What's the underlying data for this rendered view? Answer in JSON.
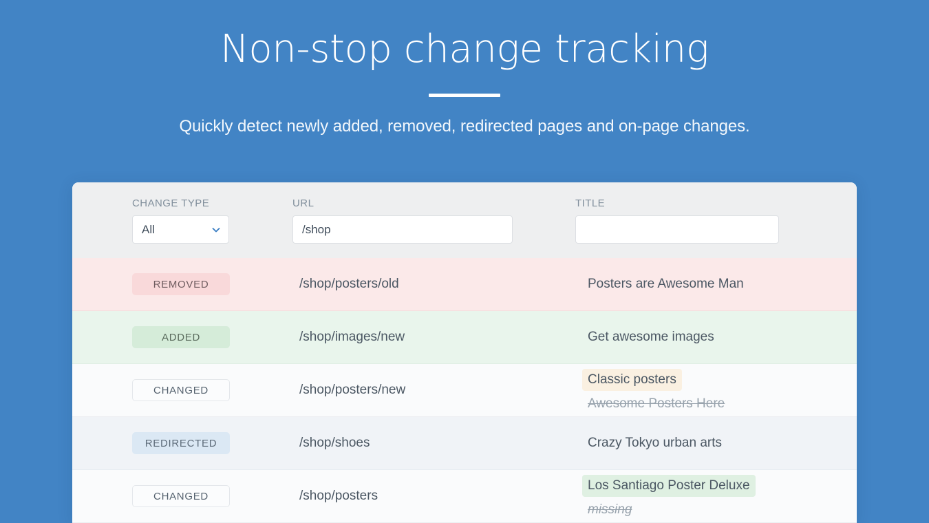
{
  "hero": {
    "title": "Non-stop change tracking",
    "subtitle": "Quickly detect newly added, removed, redirected pages and on-page changes."
  },
  "colors": {
    "background": "#4284c5",
    "accent": "#3c7fc4",
    "card": "#ffffff",
    "filter_bar": "#eeeff0",
    "row_removed": "#fbe9e9",
    "row_added": "#e9f5ec",
    "row_changed": "#fafbfc",
    "row_redirected": "#f0f3f7",
    "badge_removed": "#f9d9da",
    "badge_added": "#d5ecd9",
    "badge_redirected": "#dbe8f4",
    "highlight_cream": "#faf0e1",
    "highlight_green": "#dff0e2"
  },
  "filters": {
    "change_type": {
      "label": "Change type",
      "value": "All",
      "icon": "chevron-down-icon",
      "options": [
        "All"
      ]
    },
    "url": {
      "label": "URL",
      "value": "/shop",
      "placeholder": ""
    },
    "title": {
      "label": "Title",
      "value": "",
      "placeholder": ""
    }
  },
  "table": {
    "rows": [
      {
        "type": "Removed",
        "type_style": "removed",
        "url": "/shop/posters/old",
        "title_new": "Posters are Awesome Man",
        "title_old": null,
        "highlight": "none"
      },
      {
        "type": "Added",
        "type_style": "added",
        "url": "/shop/images/new",
        "title_new": "Get awesome images",
        "title_old": null,
        "highlight": "none"
      },
      {
        "type": "Changed",
        "type_style": "changed",
        "url": "/shop/posters/new",
        "title_new": "Classic posters",
        "title_old": "Awesome Posters Here",
        "highlight": "cream"
      },
      {
        "type": "Redirected",
        "type_style": "redirected",
        "url": "/shop/shoes",
        "title_new": "Crazy Tokyo urban arts",
        "title_old": null,
        "highlight": "none"
      },
      {
        "type": "Changed",
        "type_style": "changed",
        "url": "/shop/posters",
        "title_new": "Los Santiago Poster Deluxe",
        "title_old": "missing",
        "highlight": "green"
      }
    ]
  }
}
